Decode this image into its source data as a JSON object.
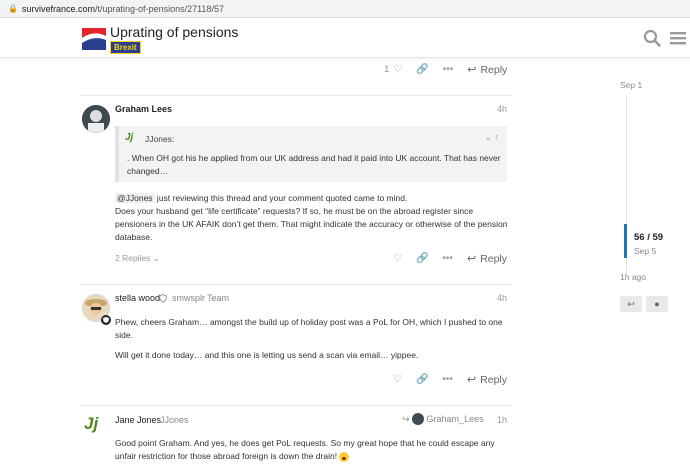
{
  "browser": {
    "url_host": "survivefrance.com",
    "url_path": "/t/uprating-of-pensions/27118/57"
  },
  "header": {
    "title": "Uprating of pensions",
    "category": "Brexit",
    "search_icon": "search-icon",
    "menu_icon": "hamburger-menu-icon"
  },
  "post0": {
    "likes": "1",
    "reply_label": "Reply"
  },
  "post1": {
    "name": "Graham Lees",
    "age": "4h",
    "quote_author": "JJones:",
    "quote_avatar": "Jj",
    "quote_text": ". When OH got his he applied from our UK address and had it paid into UK account. That has never changed…",
    "mention": "@JJones",
    "line1": " just reviewing this thread and your comment quoted came to mind.",
    "line2": "Does your husband get “life certificate” requests? If so, he must be on the abroad register since pensioners in the UK AFAIK don’t get them. That might indicate the accuracy or otherwise of the pension database.",
    "replies": "2 Replies",
    "reply_label": "Reply"
  },
  "post2": {
    "name": "stella wood",
    "username": "smwsplr",
    "title": "Team",
    "age": "4h",
    "p1": "Phew, cheers Graham… amongst the build up of holiday post was a PoL for OH, which I pushed to one side.",
    "p2": "Will get it done today… and this one is letting us send a scan via email… yippee.",
    "reply_label": "Reply"
  },
  "post3": {
    "avatar": "Jj",
    "name": "Jane Jones",
    "username": "JJones",
    "reply_to": "Graham_Lees",
    "age": "1h",
    "text": "Good point Graham. And yes, he does get PoL requests. So my great hope that he could escape any unfair restriction for those abroad foreign is down the drain!"
  },
  "timeline": {
    "top_date": "Sep 1",
    "count": "56 / 59",
    "date": "Sep 5",
    "ago": "1h ago"
  },
  "colors": {
    "accent": "#1f78b4",
    "category_bg": "#2a3f8f",
    "category_fg": "#ffd400"
  }
}
